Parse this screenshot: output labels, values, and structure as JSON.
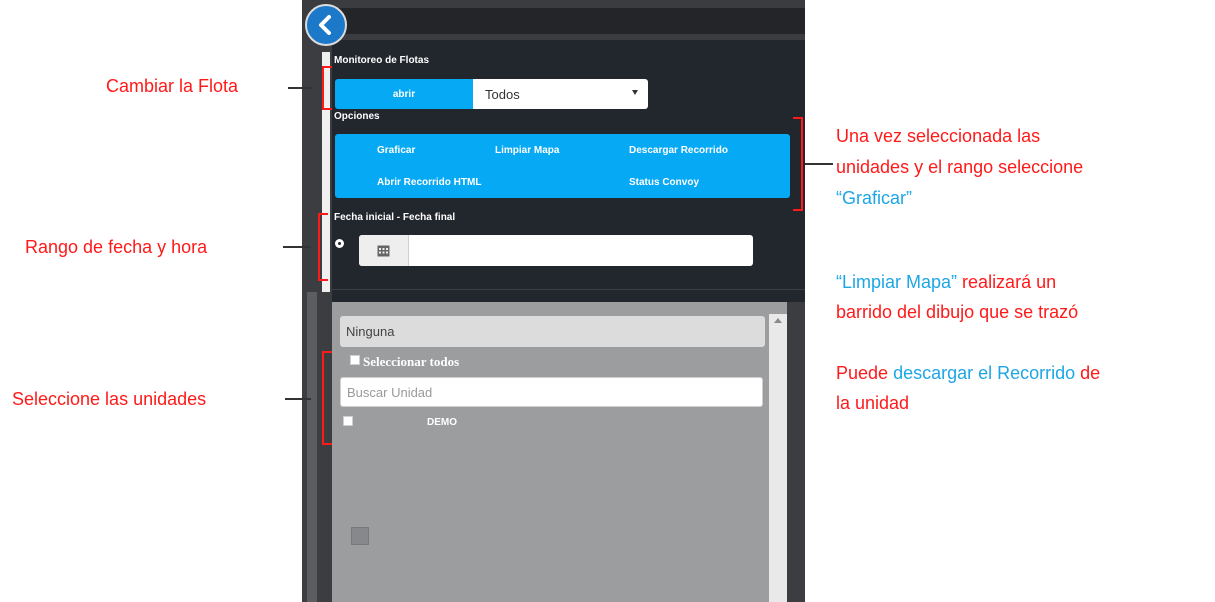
{
  "panel": {
    "fleet_section_title": "Monitoreo de Flotas",
    "open_button_label": "abrir",
    "fleet_select_value": "Todos",
    "options_title": "Opciones",
    "options": {
      "graficar": "Graficar",
      "limpiar_mapa": "Limpiar Mapa",
      "descargar_recorrido": "Descargar Recorrido",
      "abrir_recorrido_html": "Abrir Recorrido HTML",
      "status_convoy": "Status Convoy"
    },
    "date_range_title": "Fecha inicial - Fecha final",
    "date_range_value": "",
    "units": {
      "fleet_dropdown_value": "Ninguna",
      "select_all_label": "Seleccionar todos",
      "search_placeholder": "Buscar Unidad",
      "items": [
        {
          "label": "DEMO"
        }
      ]
    }
  },
  "annotations": {
    "change_fleet": "Cambiar la Flota",
    "date_range": "Rango de fecha y hora",
    "select_units": "Seleccione las unidades",
    "graficar_note_line1": "Una vez seleccionada las",
    "graficar_note_line2": "unidades y el rango  seleccione",
    "graficar_note_quote": "“Graficar”",
    "clear_note_quote": "“Limpiar Mapa”",
    "clear_note_rest1": " realizará un",
    "clear_note_line2": "barrido del dibujo que se trazó",
    "download_note_start": "Puede ",
    "download_note_highlight": "descargar el Recorrido",
    "download_note_end": " de",
    "download_note_line2": "la unidad"
  },
  "icons": {
    "back": "chevron-left-icon",
    "calendar": "calendar-icon",
    "dropdown_caret": "caret-down-icon"
  },
  "colors": {
    "accent_blue": "#06a9f4",
    "annotation_red": "#ff1a1a",
    "annotation_blue": "#1da6e6",
    "panel_dark": "#22262d"
  }
}
